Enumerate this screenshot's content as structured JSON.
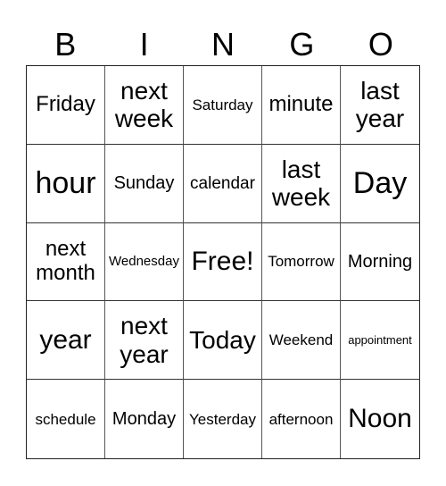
{
  "header": [
    "B",
    "I",
    "N",
    "G",
    "O"
  ],
  "cells": [
    "Friday",
    "next week",
    "Saturday",
    "minute",
    "last year",
    "hour",
    "Sunday",
    "calendar",
    "last week",
    "Day",
    "next month",
    "Wednesday",
    "Free!",
    "Tomorrow",
    "Morning",
    "year",
    "next year",
    "Today",
    "Weekend",
    "appointment",
    "schedule",
    "Monday",
    "Yesterday",
    "afternoon",
    "Noon"
  ]
}
